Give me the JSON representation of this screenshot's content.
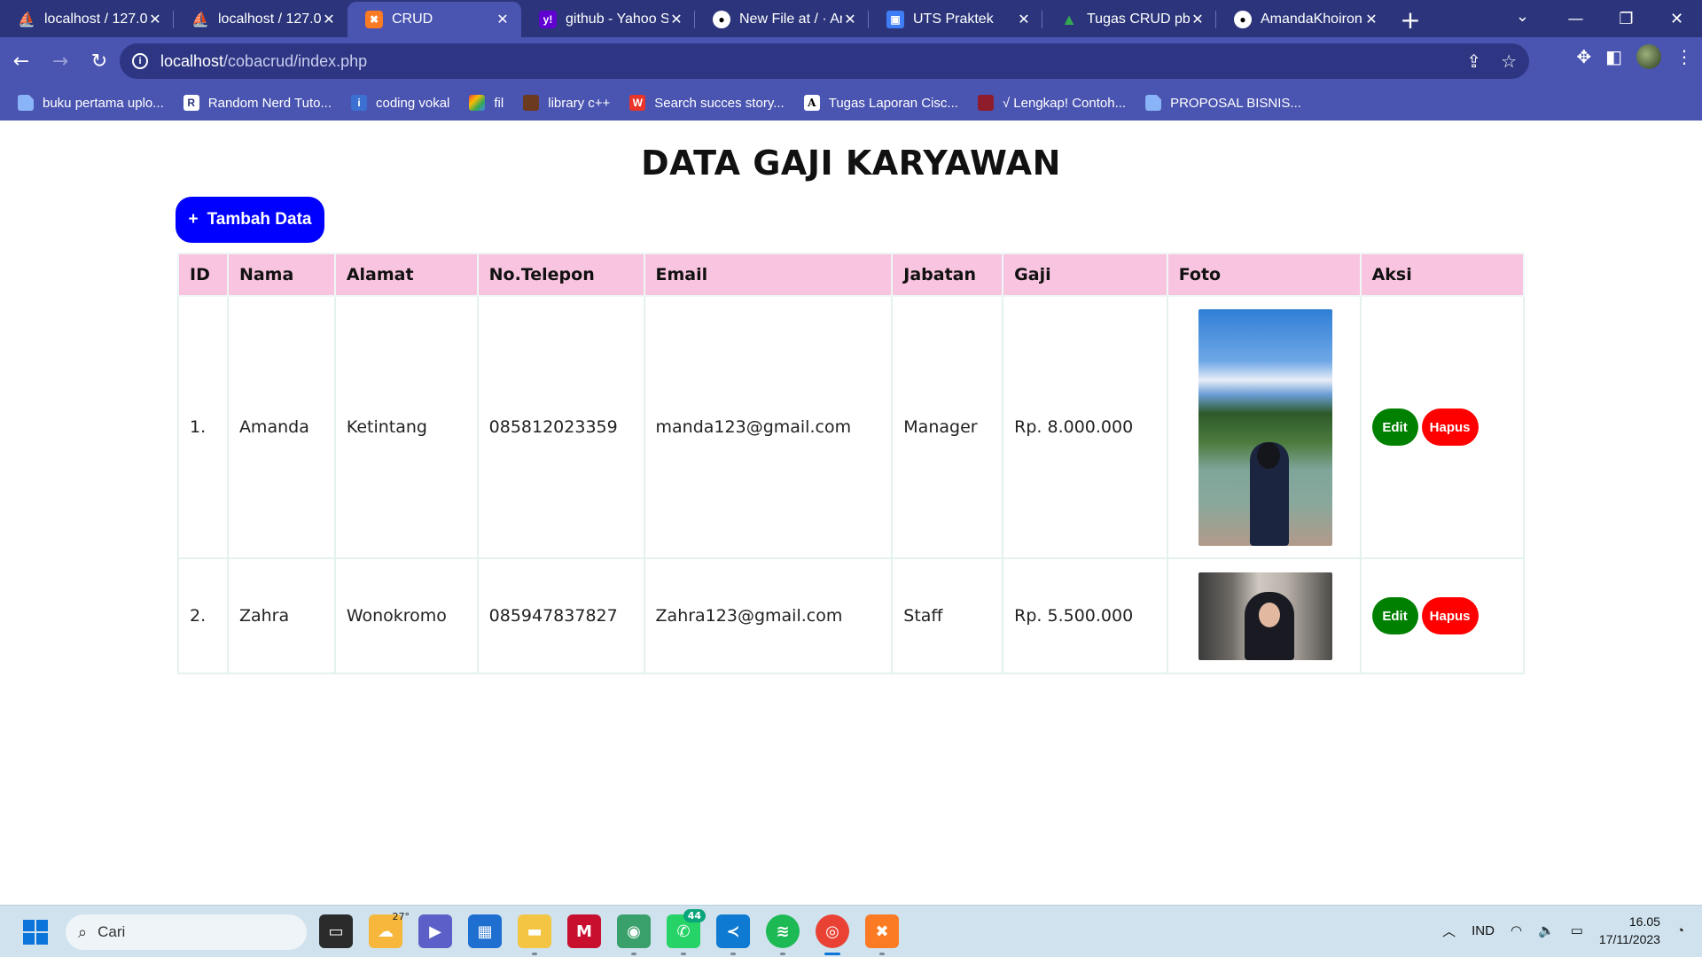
{
  "browser": {
    "tabs": [
      {
        "title": "localhost / 127.0.",
        "icon": "phpmyadmin-icon",
        "active": false
      },
      {
        "title": "localhost / 127.0.",
        "icon": "phpmyadmin-icon",
        "active": false
      },
      {
        "title": "CRUD",
        "icon": "xampp-icon",
        "active": true
      },
      {
        "title": "github - Yahoo S",
        "icon": "yahoo-icon",
        "active": false
      },
      {
        "title": "New File at / · Ar",
        "icon": "github-icon",
        "active": false
      },
      {
        "title": "UTS Praktek",
        "icon": "classroom-icon",
        "active": false
      },
      {
        "title": "Tugas CRUD pbo",
        "icon": "google-drive-icon",
        "active": false
      },
      {
        "title": "AmandaKhoiron",
        "icon": "github-icon",
        "active": false
      }
    ],
    "url_host": "localhost",
    "url_path": "/cobacrud/index.php",
    "bookmarks": [
      {
        "label": "buku pertama uplo...",
        "icon": "document-icon"
      },
      {
        "label": "Random Nerd Tuto...",
        "icon": "r-logo-icon"
      },
      {
        "label": "coding vokal",
        "icon": "coding-icon"
      },
      {
        "label": "fil",
        "icon": "colorful-icon"
      },
      {
        "label": "library c++",
        "icon": "profile-photo-icon"
      },
      {
        "label": "Search succes story...",
        "icon": "w-logo-icon"
      },
      {
        "label": "Tugas Laporan Cisc...",
        "icon": "a-logo-icon"
      },
      {
        "label": "√ Lengkap! Contoh...",
        "icon": "red-circle-icon"
      },
      {
        "label": "PROPOSAL BISNIS...",
        "icon": "document-icon"
      }
    ]
  },
  "page": {
    "title": "DATA GAJI KARYAWAN",
    "add_button": "Tambah Data",
    "add_button_icon": "+",
    "columns": [
      "ID",
      "Nama",
      "Alamat",
      "No.Telepon",
      "Email",
      "Jabatan",
      "Gaji",
      "Foto",
      "Aksi"
    ],
    "rows": [
      {
        "id": "1.",
        "nama": "Amanda",
        "alamat": "Ketintang",
        "telepon": "085812023359",
        "email": "manda123@gmail.com",
        "jabatan": "Manager",
        "gaji": "Rp. 8.000.000",
        "edit": "Edit",
        "hapus": "Hapus"
      },
      {
        "id": "2.",
        "nama": "Zahra",
        "alamat": "Wonokromo",
        "telepon": "085947837827",
        "email": "Zahra123@gmail.com",
        "jabatan": "Staff",
        "gaji": "Rp. 5.500.000",
        "edit": "Edit",
        "hapus": "Hapus"
      }
    ],
    "colors": {
      "header_bg": "#f8c4df",
      "add_button": "#0000ff",
      "edit_button": "#008000",
      "hapus_button": "#ff0000"
    }
  },
  "taskbar": {
    "search_placeholder": "Cari",
    "weather_temp": "27°",
    "whatsapp_badge": "44",
    "language": "IND",
    "time": "16.05",
    "date": "17/11/2023"
  }
}
